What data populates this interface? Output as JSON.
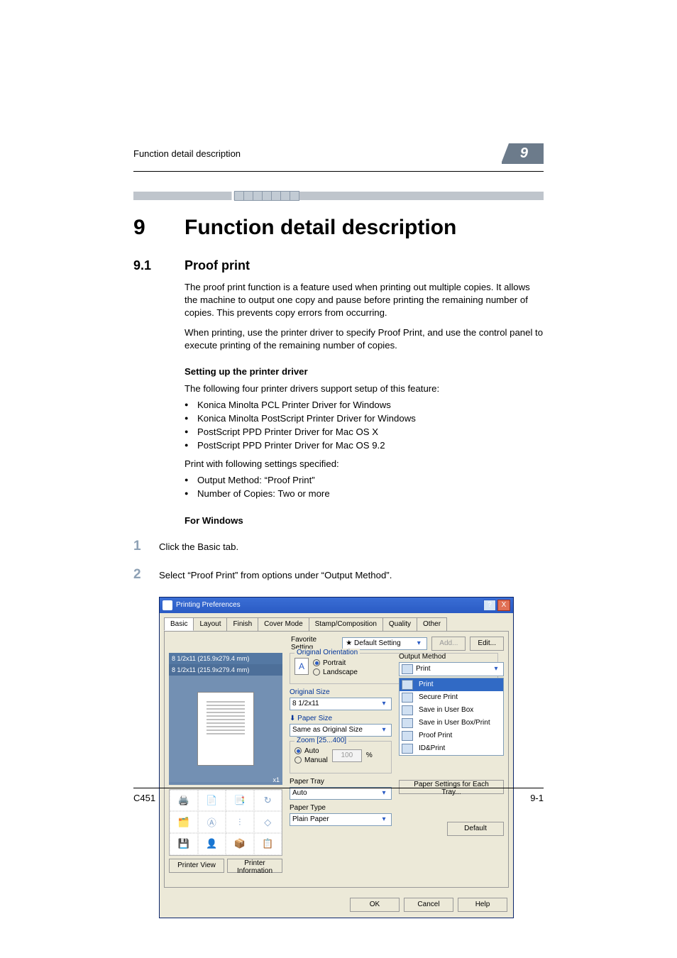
{
  "header": {
    "running": "Function detail description",
    "chapter_badge": "9"
  },
  "h1": {
    "num": "9",
    "title": "Function detail description"
  },
  "h2": {
    "num": "9.1",
    "title": "Proof print"
  },
  "paras": {
    "p1": "The proof print function is a feature used when printing out multiple copies. It allows the machine to output one copy and pause before printing the remaining number of copies. This prevents copy errors from occurring.",
    "p2": "When printing, use the printer driver to specify Proof Print, and use the control panel to execute printing of the remaining number of copies."
  },
  "setup": {
    "heading": "Setting up the printer driver",
    "intro": "The following four printer drivers support setup of this feature:",
    "drivers": [
      "Konica Minolta PCL Printer Driver for Windows",
      "Konica Minolta PostScript Printer Driver for Windows",
      "PostScript PPD Printer Driver for Mac OS X",
      "PostScript PPD Printer Driver for Mac OS 9.2"
    ],
    "intro2": "Print with following settings specified:",
    "settings": [
      "Output Method: “Proof Print”",
      "Number of Copies: Two or more"
    ]
  },
  "windows": {
    "heading": "For Windows",
    "steps": [
      {
        "n": "1",
        "t": "Click the Basic tab."
      },
      {
        "n": "2",
        "t": "Select “Proof Print” from options under “Output Method”."
      }
    ]
  },
  "dialog": {
    "title": "Printing Preferences",
    "help_btn": "?",
    "close_btn": "X",
    "tabs": [
      "Basic",
      "Layout",
      "Finish",
      "Cover Mode",
      "Stamp/Composition",
      "Quality",
      "Other"
    ],
    "favorite": {
      "label": "Favorite Setting",
      "value": "Default Setting",
      "add": "Add...",
      "edit": "Edit..."
    },
    "preview": {
      "top": "8 1/2x11 (215.9x279.4 mm)",
      "mid": "8 1/2x11 (215.9x279.4 mm)",
      "xf": "x1"
    },
    "preview_buttons": {
      "view": "Printer View",
      "info": "Printer Information"
    },
    "orientation": {
      "legend": "Original Orientation",
      "portrait": "Portrait",
      "landscape": "Landscape"
    },
    "original_size": {
      "label": "Original Size",
      "value": "8 1/2x11"
    },
    "paper_size": {
      "label": "Paper Size",
      "value": "Same as Original Size"
    },
    "zoom": {
      "legend": "Zoom [25...400]",
      "auto": "Auto",
      "manual": "Manual",
      "value": "100",
      "pct": "%"
    },
    "paper_tray": {
      "label": "Paper Tray",
      "value": "Auto"
    },
    "paper_type": {
      "label": "Paper Type",
      "value": "Plain Paper"
    },
    "output": {
      "label": "Output Method",
      "selected": "Print",
      "options": [
        "Print",
        "Secure Print",
        "Save in User Box",
        "Save in User Box/Print",
        "Proof Print",
        "ID&Print"
      ]
    },
    "paper_settings_btn": "Paper Settings for Each Tray...",
    "default_btn": "Default",
    "footer": {
      "ok": "OK",
      "cancel": "Cancel",
      "help": "Help"
    }
  },
  "footer": {
    "model": "C451",
    "page": "9-1"
  }
}
